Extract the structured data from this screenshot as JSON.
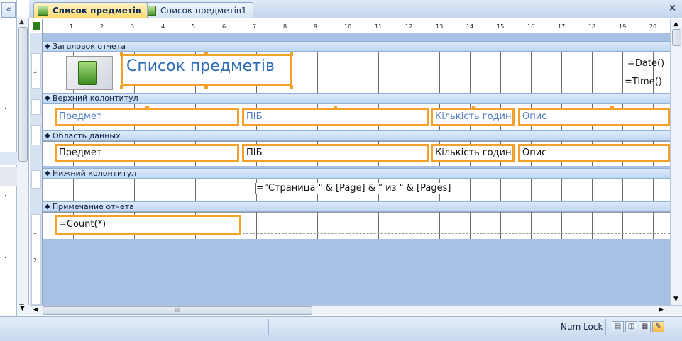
{
  "tabs": [
    {
      "label": "Список предметів",
      "active": true,
      "icon": "report-icon"
    },
    {
      "label": "Список предметів1",
      "active": false,
      "icon": "report-icon"
    }
  ],
  "window": {
    "close_glyph": "×",
    "collapse_glyph": "«"
  },
  "ruler": {
    "ticks": [
      "1",
      "2",
      "3",
      "4",
      "5",
      "6",
      "7",
      "8",
      "9",
      "10",
      "11",
      "12",
      "13",
      "14",
      "15",
      "16",
      "17",
      "18",
      "19",
      "20"
    ]
  },
  "sections": {
    "report_header": "Заголовок отчета",
    "page_header": "Верхний колонтитул",
    "detail": "Область данных",
    "page_footer": "Нижний колонтитул",
    "report_footer": "Примечание отчета"
  },
  "report_header": {
    "title": "Список предметів",
    "date_expr": "=Date()",
    "time_expr": "=Time()"
  },
  "page_header": {
    "labels": [
      "Предмет",
      "ПІБ",
      "Кількість годин",
      "Опис"
    ]
  },
  "detail": {
    "fields": [
      "Предмет",
      "ПІБ",
      "Кількість годин",
      "Опис"
    ]
  },
  "page_footer": {
    "page_expr": "=\"Страница \" & [Page] & \" из \" & [Pages]"
  },
  "report_footer": {
    "count_expr": "=Count(*)"
  },
  "vruler_marks": {
    "r1": "1",
    "r2": "1",
    "r3": "2"
  },
  "scroll_grip": "III",
  "status": {
    "num_lock": "Num Lock",
    "view_buttons": [
      "report-view-icon",
      "print-preview-icon",
      "layout-view-icon",
      "design-view-icon"
    ]
  },
  "colors": {
    "selection": "#f4a12c",
    "section_bg": "#a7c1e4",
    "active_tab": "#ffd96a"
  }
}
